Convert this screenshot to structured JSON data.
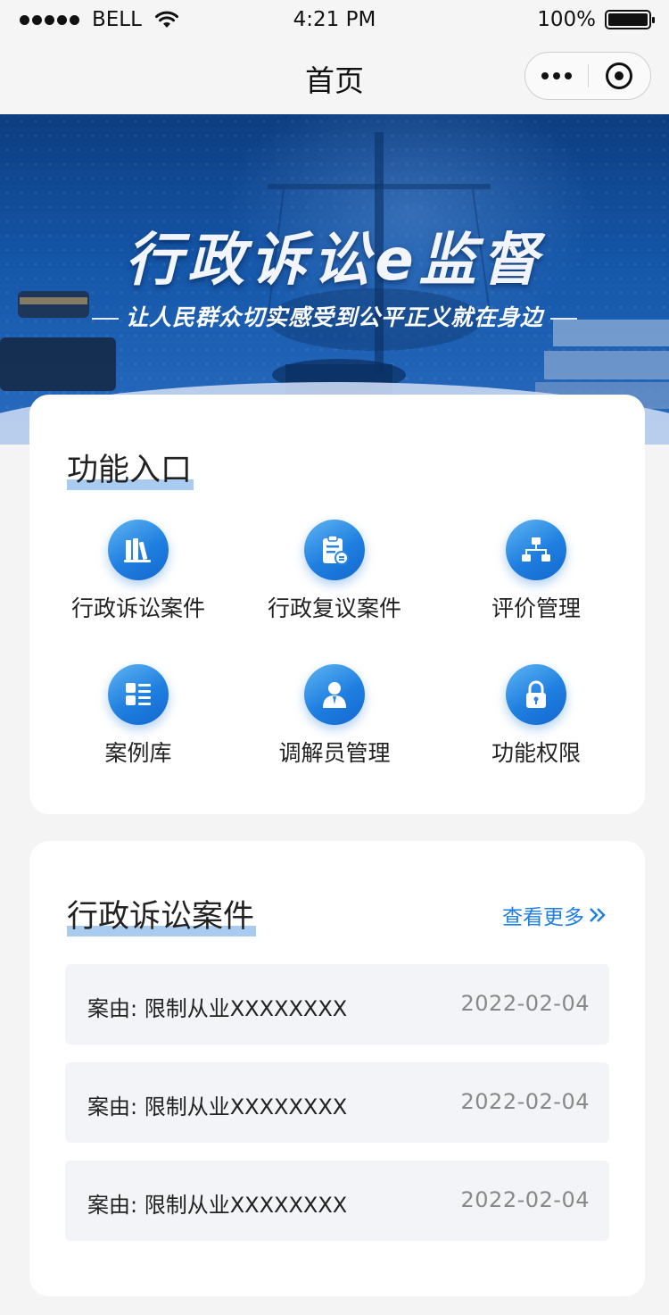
{
  "status_bar": {
    "carrier": "BELL",
    "time": "4:21 PM",
    "battery": "100%"
  },
  "nav": {
    "title": "首页"
  },
  "banner": {
    "title": "行政诉讼e监督",
    "subtitle": "让人民群众切实感受到公平正义就在身边"
  },
  "functions": {
    "title": "功能入口",
    "items": [
      {
        "label": "行政诉讼案件",
        "icon": "books-icon"
      },
      {
        "label": "行政复议案件",
        "icon": "clipboard-icon"
      },
      {
        "label": "评价管理",
        "icon": "hierarchy-icon"
      },
      {
        "label": "案例库",
        "icon": "list-icon"
      },
      {
        "label": "调解员管理",
        "icon": "user-icon"
      },
      {
        "label": "功能权限",
        "icon": "lock-icon"
      }
    ]
  },
  "cases": {
    "title": "行政诉讼案件",
    "more_label": "查看更多",
    "rows": [
      {
        "reason": "案由: 限制从业XXXXXXXX",
        "date": "2022-02-04"
      },
      {
        "reason": "案由: 限制从业XXXXXXXX",
        "date": "2022-02-04"
      },
      {
        "reason": "案由: 限制从业XXXXXXXX",
        "date": "2022-02-04"
      }
    ]
  },
  "colors": {
    "accent": "#1f7fe0",
    "banner": "#1456a8",
    "highlight": "#a8cbef"
  }
}
